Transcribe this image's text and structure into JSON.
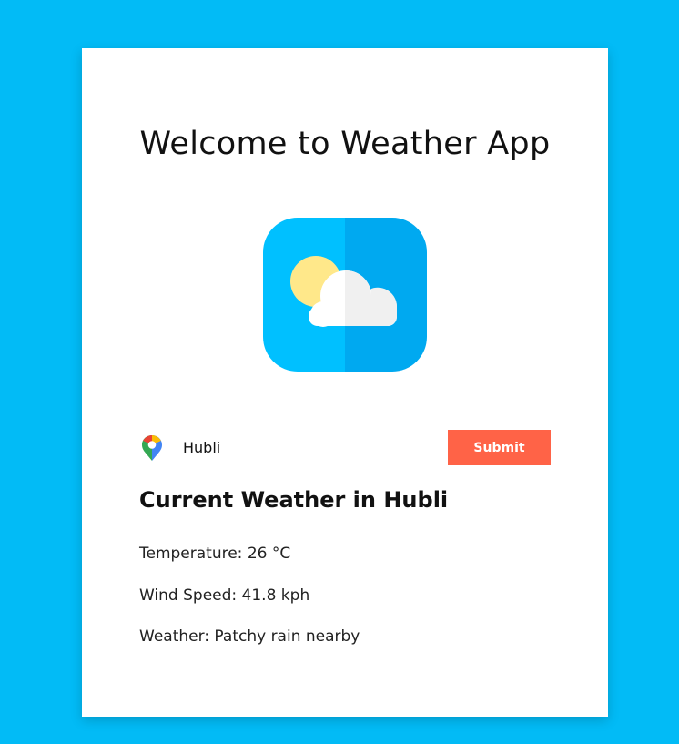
{
  "header": {
    "title": "Welcome to Weather App"
  },
  "icons": {
    "app_icon": "weather-partly-cloudy-icon",
    "location_icon": "map-pin-icon"
  },
  "search": {
    "city_value": "Hubli",
    "submit_label": "Submit"
  },
  "result": {
    "heading": "Current Weather in Hubli",
    "temperature": "Temperature: 26 °C",
    "wind_speed": "Wind Speed: 41.8 kph",
    "weather": "Weather: Patchy rain nearby"
  },
  "colors": {
    "background": "#02bbf6",
    "card": "#ffffff",
    "submit": "#ff6347",
    "icon_left": "#00c0ff",
    "icon_right": "#00a9f0"
  }
}
